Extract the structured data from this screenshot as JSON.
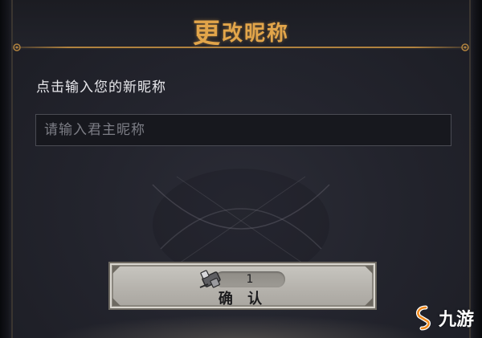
{
  "dialog": {
    "title_first": "更",
    "title_rest": "改昵称",
    "prompt": "点击输入您的新昵称",
    "input_placeholder": "请输入君主昵称",
    "input_value": ""
  },
  "confirm": {
    "cost_value": "1",
    "label": "确 认",
    "cost_icon": "rename-scroll-icon"
  },
  "watermark": {
    "text": "九游",
    "logo_icon": "jiuyou-logo-icon"
  },
  "colors": {
    "title": "#e2a54a",
    "panel": "#23242d",
    "button": "#bebbb5",
    "accent_line": "#b0823f"
  }
}
